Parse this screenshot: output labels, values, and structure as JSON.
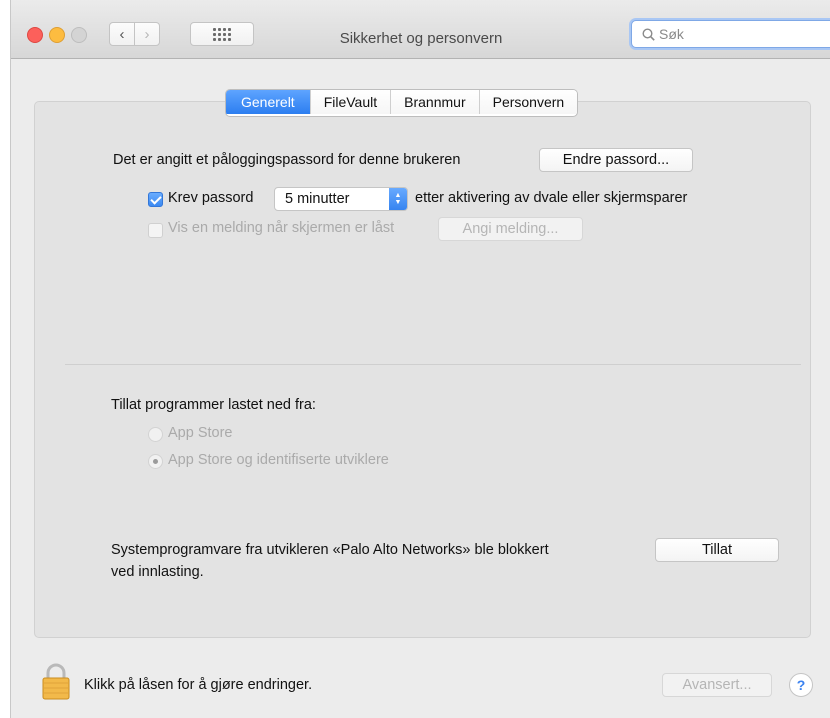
{
  "window": {
    "title": "Sikkerhet og personvern",
    "search_placeholder": "Søk"
  },
  "tabs": [
    {
      "label": "Generelt",
      "active": true
    },
    {
      "label": "FileVault",
      "active": false
    },
    {
      "label": "Brannmur",
      "active": false
    },
    {
      "label": "Personvern",
      "active": false
    }
  ],
  "general": {
    "password_text": "Det er angitt et påloggingspassord for denne brukeren",
    "change_password_button": "Endre passord...",
    "require_password": {
      "label": "Krev passord",
      "checked": true,
      "delay_selected": "5 minutter",
      "suffix": "etter aktivering av dvale eller skjermsparer"
    },
    "show_message": {
      "label": "Vis en melding når skjermen er låst",
      "checked": false,
      "enabled": false,
      "button": "Angi melding..."
    }
  },
  "downloads": {
    "heading": "Tillat programmer lastet ned fra:",
    "options": [
      {
        "label": "App Store",
        "selected": false
      },
      {
        "label": "App Store og identifiserte utviklere",
        "selected": true
      }
    ]
  },
  "blocked": {
    "message_line1": "Systemprogramvare fra utvikleren «Palo Alto Networks» ble blokkert",
    "message_line2": "ved innlasting.",
    "allow_button": "Tillat"
  },
  "footer": {
    "lock_text": "Klikk på låsen for å gjøre endringer.",
    "advanced_button": "Avansert...",
    "help_label": "?"
  },
  "colors": {
    "accent": "#3a86f2",
    "close": "#fc605b",
    "minimize": "#fdbc40",
    "zoom_inactive": "#d4d4d4"
  }
}
